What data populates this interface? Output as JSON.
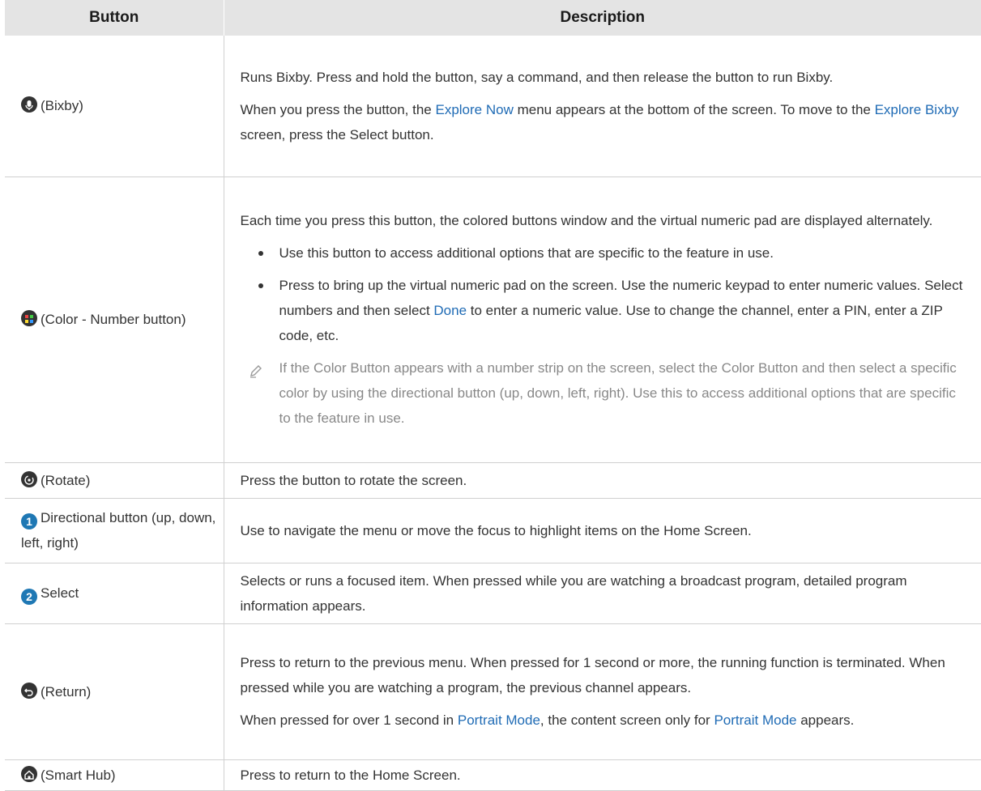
{
  "table": {
    "headers": [
      "Button",
      "Description"
    ],
    "rows": {
      "bixby": {
        "icon": "microphone-icon",
        "label": "(Bixby)",
        "p1": "Runs Bixby. Press and hold the button, say a command, and then release the button to run Bixby.",
        "p2_a": "When you press the button, the ",
        "p2_link1": "Explore Now",
        "p2_b": " menu appears at the bottom of the screen. To move to the ",
        "p2_link2": "Explore Bixby",
        "p2_c": " screen, press the Select button."
      },
      "color": {
        "icon": "color-number-icon",
        "label": "(Color - Number button)",
        "intro": "Each time you press this button, the colored buttons window and the virtual numeric pad are displayed alternately.",
        "bullet1": "Use this button to access additional options that are specific to the feature in use.",
        "bullet2_a": "Press to bring up the virtual numeric pad on the screen. Use the numeric keypad to enter numeric values. Select numbers and then select ",
        "bullet2_link": "Done",
        "bullet2_b": " to enter a numeric value. Use to change the channel, enter a PIN, enter a ZIP code, etc.",
        "note": "If the Color Button appears with a number strip on the screen, select the Color Button and then select a specific color by using the directional button (up, down, left, right). Use this to access additional options that are specific to the feature in use."
      },
      "rotate": {
        "icon": "rotate-icon",
        "label": "(Rotate)",
        "desc": "Press the button to rotate the screen."
      },
      "directional": {
        "badge": "1",
        "label": "Directional button (up, down, left, right)",
        "desc": "Use to navigate the menu or move the focus to highlight items on the Home Screen."
      },
      "select": {
        "badge": "2",
        "label": "Select",
        "desc": "Selects or runs a focused item. When pressed while you are watching a broadcast program, detailed program information appears."
      },
      "return": {
        "icon": "return-icon",
        "label": "(Return)",
        "p1": "Press to return to the previous menu. When pressed for 1 second or more, the running function is terminated. When pressed while you are watching a program, the previous channel appears.",
        "p2_a": "When pressed for over 1 second in ",
        "p2_link1": "Portrait Mode",
        "p2_b": ", the content screen only for ",
        "p2_link2": "Portrait Mode",
        "p2_c": " appears."
      },
      "smarthub": {
        "icon": "home-icon",
        "label": "(Smart Hub)",
        "desc": "Press to return to the Home Screen."
      }
    }
  },
  "colors": {
    "header_bg": "#e4e4e4",
    "link": "#1f6bb5",
    "badge": "#1f78b4",
    "note": "#888888"
  }
}
